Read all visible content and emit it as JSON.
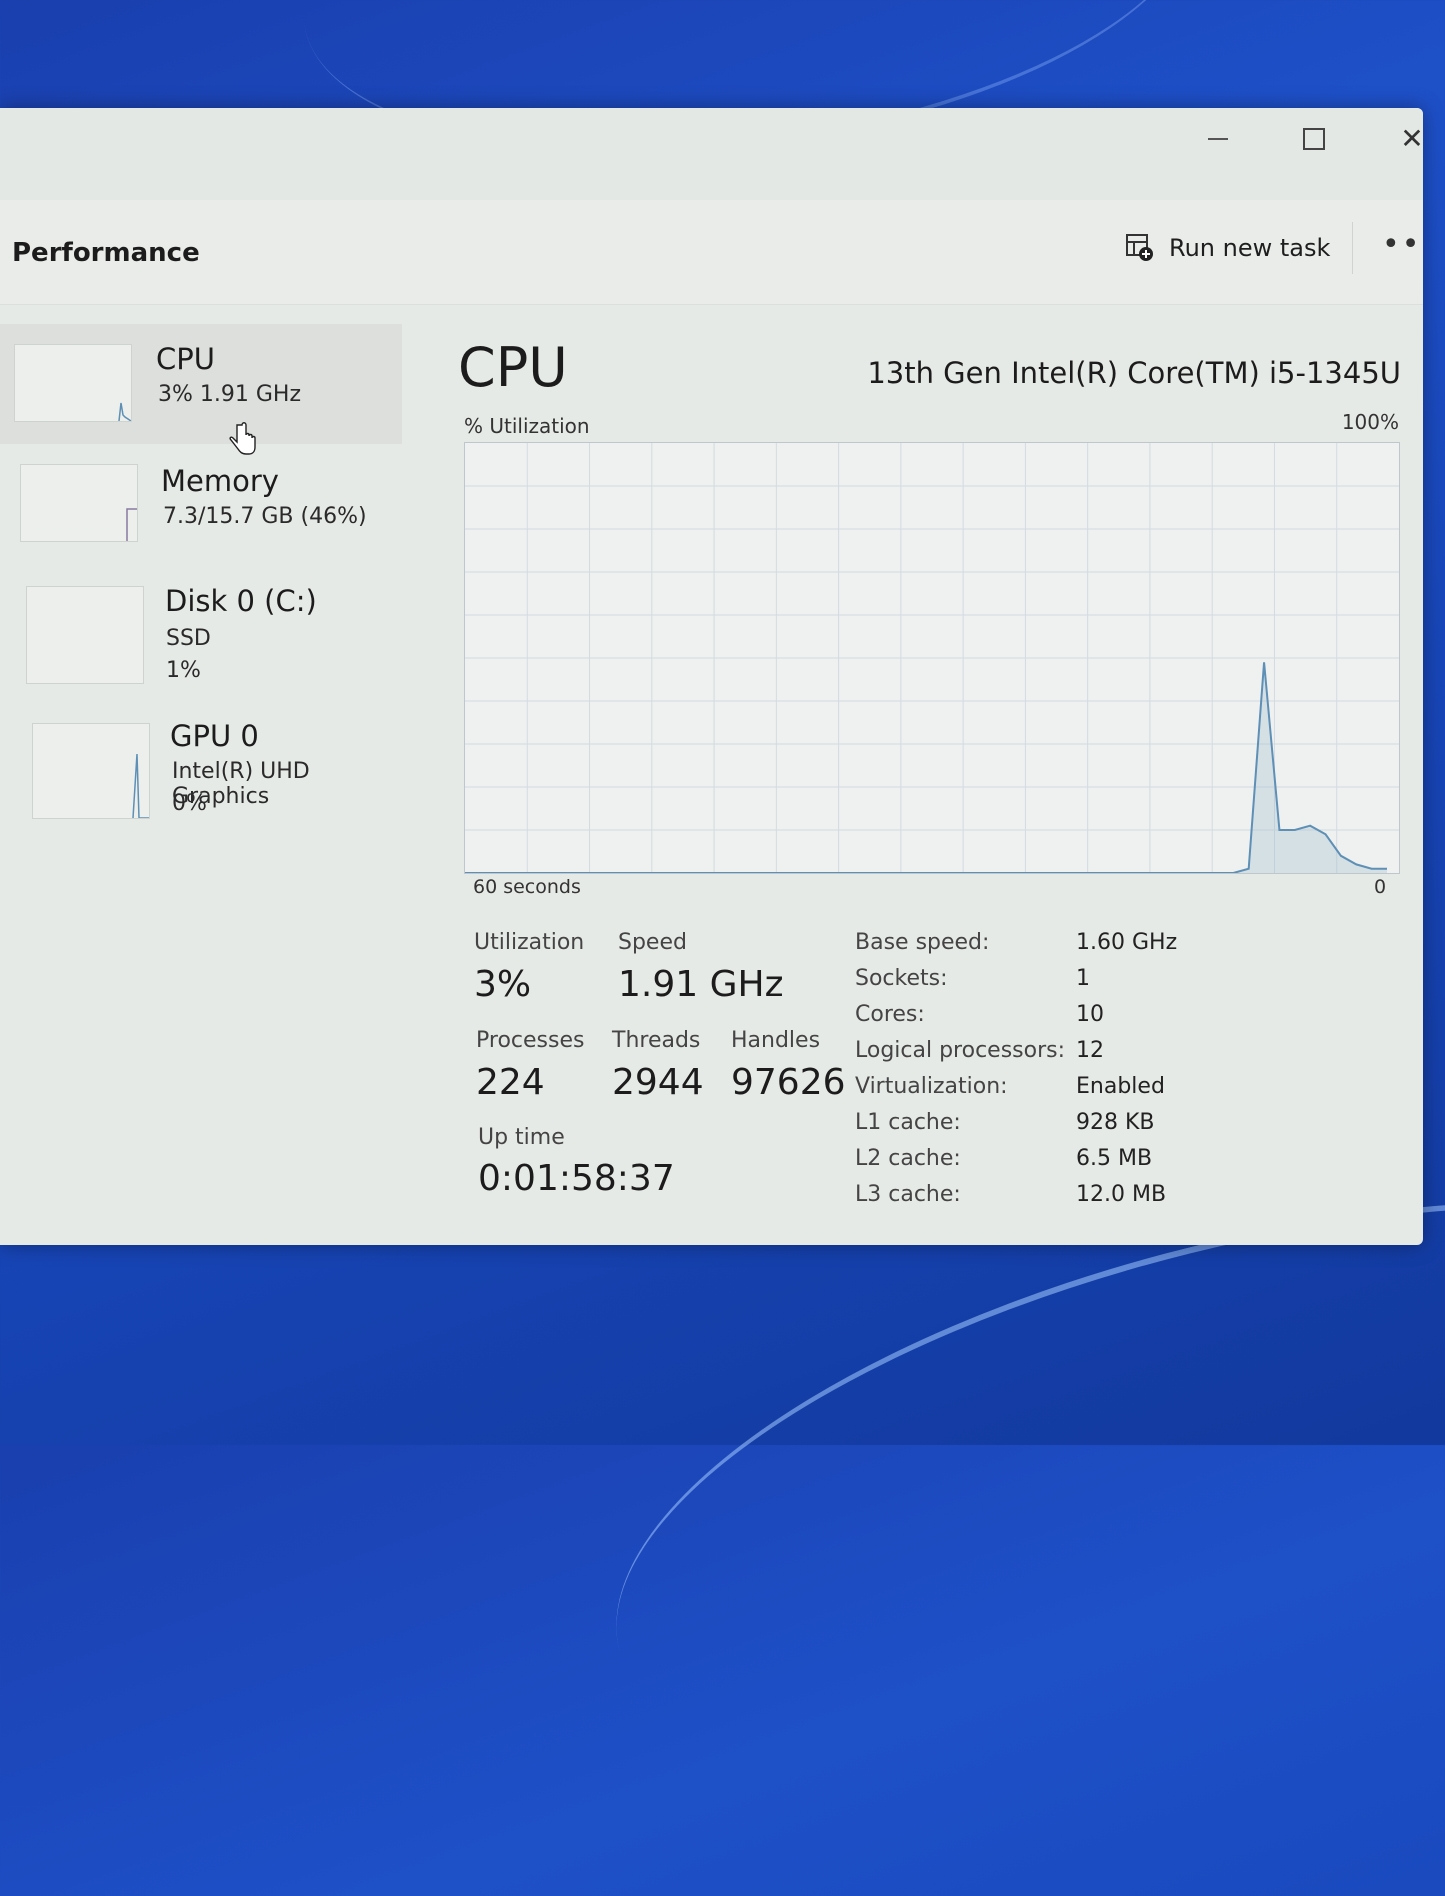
{
  "window": {
    "page_title": "Performance",
    "run_new_task": "Run new task",
    "more_label": "•••",
    "close_glyph": "✕"
  },
  "sidebar": {
    "items": [
      {
        "name": "CPU",
        "line1": "3%  1.91 GHz",
        "line2": "",
        "icon": "cpu-sparkline",
        "selected": true
      },
      {
        "name": "Memory",
        "line1": "7.3/15.7 GB (46%)",
        "line2": "",
        "icon": "memory-sparkline"
      },
      {
        "name": "Disk 0 (C:)",
        "line1": "SSD",
        "line2": "1%",
        "icon": "disk-sparkline"
      },
      {
        "name": "GPU 0",
        "line1": "Intel(R) UHD Graphics",
        "line2": "0%",
        "icon": "gpu-sparkline"
      }
    ]
  },
  "main": {
    "title": "CPU",
    "model": "13th Gen Intel(R) Core(TM) i5-1345U",
    "util_label": "% Utilization",
    "max_label": "100%",
    "time_label": "60 seconds",
    "min_label": "0",
    "stats": {
      "utilization": {
        "label": "Utilization",
        "value": "3%"
      },
      "speed": {
        "label": "Speed",
        "value": "1.91 GHz"
      },
      "processes": {
        "label": "Processes",
        "value": "224"
      },
      "threads": {
        "label": "Threads",
        "value": "2944"
      },
      "handles": {
        "label": "Handles",
        "value": "97626"
      },
      "uptime": {
        "label": "Up time",
        "value": "0:01:58:37"
      }
    },
    "details": [
      {
        "key": "Base speed:",
        "value": "1.60 GHz"
      },
      {
        "key": "Sockets:",
        "value": "1"
      },
      {
        "key": "Cores:",
        "value": "10"
      },
      {
        "key": "Logical processors:",
        "value": "12"
      },
      {
        "key": "Virtualization:",
        "value": "Enabled"
      },
      {
        "key": "L1 cache:",
        "value": "928 KB"
      },
      {
        "key": "L2 cache:",
        "value": "6.5 MB"
      },
      {
        "key": "L3 cache:",
        "value": "12.0 MB"
      }
    ]
  },
  "colors": {
    "graph_line": "#5e8fb5",
    "graph_grid": "#d3dbe0",
    "desktop_blue": "#1e50c8"
  },
  "chart_data": {
    "type": "area",
    "ylim": [
      0,
      100
    ],
    "x": [
      0,
      5,
      10,
      15,
      20,
      25,
      30,
      35,
      40,
      45,
      50,
      51,
      52,
      53,
      54,
      55,
      56,
      57,
      58,
      59,
      60
    ],
    "series": [
      {
        "values": [
          0,
          0,
          0,
          0,
          0,
          0,
          0,
          0,
          0,
          0,
          0,
          1,
          49,
          10,
          10,
          11,
          9,
          4,
          2,
          1,
          1
        ]
      }
    ]
  }
}
